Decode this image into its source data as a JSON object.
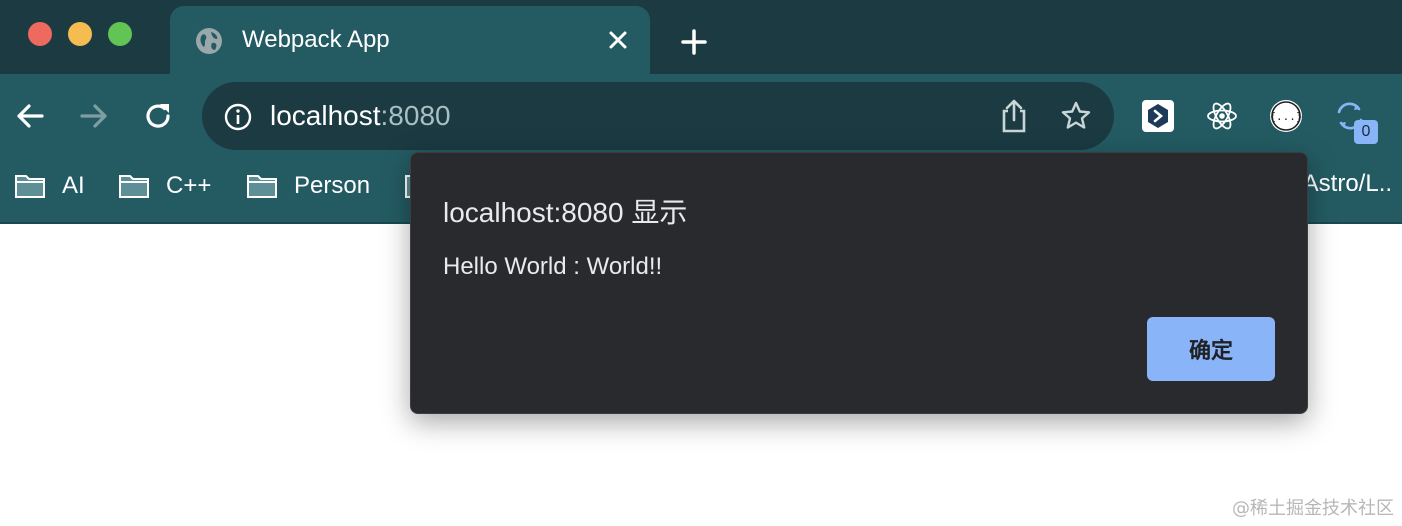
{
  "tab": {
    "title": "Webpack App"
  },
  "address": {
    "host": "localhost",
    "port": ":8080"
  },
  "bookmarks": [
    {
      "label": "AI"
    },
    {
      "label": "C++"
    },
    {
      "label": "Person"
    }
  ],
  "bookmarks_overflow_text": "/Astro/L..",
  "extensions": {
    "badge_count": "0"
  },
  "dialog": {
    "title": "localhost:8080 显示",
    "message": "Hello World : World!!",
    "ok_label": "确定"
  },
  "watermark": "@稀土掘金技术社区",
  "colors": {
    "tabbar": "#1b3a42",
    "toolbar": "#245b63",
    "dialog_bg": "#292a2d",
    "dialog_button": "#8ab4f8"
  }
}
